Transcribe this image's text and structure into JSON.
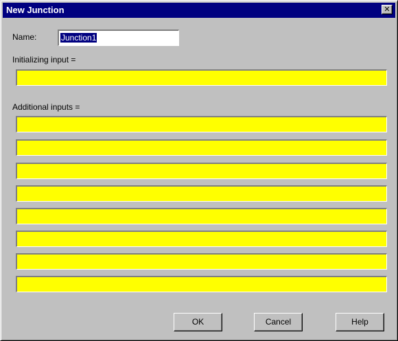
{
  "dialog": {
    "title": "New Junction",
    "close_label": "✕"
  },
  "form": {
    "name_label": "Name:",
    "name_value": "Junction1",
    "initializing_label": "Initializing input =",
    "initializing_value": "",
    "additional_label": "Additional inputs =",
    "additional_inputs": [
      "",
      "",
      "",
      "",
      "",
      "",
      "",
      ""
    ],
    "field_color": "#ffff00"
  },
  "buttons": {
    "ok": "OK",
    "cancel": "Cancel",
    "help": "Help"
  }
}
